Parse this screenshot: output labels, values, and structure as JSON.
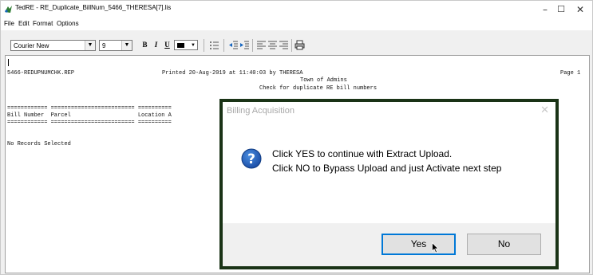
{
  "window": {
    "title": "TedRE - RE_Duplicate_BillNum_5466_THERESA[7].lis",
    "minimize_glyph": "–",
    "maximize_glyph": "☐",
    "close_glyph": "✕"
  },
  "menu": {
    "file": "File",
    "edit": "Edit",
    "format": "Format",
    "options": "Options"
  },
  "toolbar": {
    "font_value": "Courier New",
    "size_value": "9",
    "bold": "B",
    "italic": "I",
    "underline": "U"
  },
  "report": {
    "filename": "5466-REDUPNUMCHK.REP",
    "printed_line": "Printed 20-Aug-2019 at 11:40:03 by THERESA",
    "page": "Page 1",
    "town": "Town of Admins",
    "subtitle": "Check for duplicate RE bill numbers",
    "rule_line": "============ ========================= ==========",
    "header_line": "Bill Number  Parcel                    Location A",
    "no_records": "No Records Selected"
  },
  "dialog": {
    "title": "Billing Acquisition",
    "close_glyph": "✕",
    "message_line1": "Click YES to continue with Extract Upload.",
    "message_line2": "Click NO to Bypass Upload and just Activate next step",
    "yes_label": "Yes",
    "no_label": "No",
    "icon": "question-icon",
    "border_color": "#1a3316",
    "accent_color": "#0078d7"
  }
}
